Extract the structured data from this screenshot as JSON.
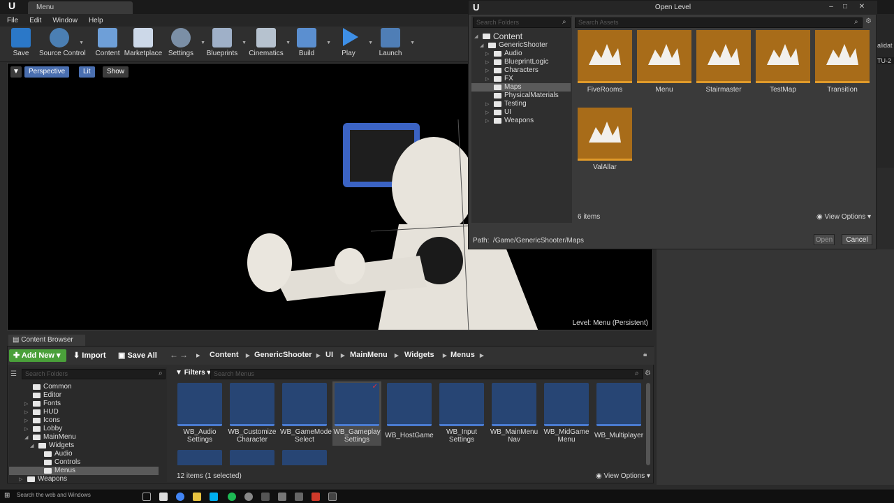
{
  "window": {
    "doc_tab": "Menu",
    "ue_logo": "U"
  },
  "menubar": [
    "File",
    "Edit",
    "Window",
    "Help"
  ],
  "toolbar": [
    "Save",
    "Source Control",
    "Content",
    "Marketplace",
    "Settings",
    "Blueprints",
    "Cinematics",
    "Build",
    "Play",
    "Launch"
  ],
  "viewport": {
    "perspective": "Perspective",
    "lit": "Lit",
    "show": "Show",
    "level_prefix": "Level:",
    "level_name": "Menu (Persistent)"
  },
  "open_level": {
    "title": "Open Level",
    "search_folders_placeholder": "Search Folders",
    "search_assets_placeholder": "Search Assets",
    "tree": [
      {
        "label": "Content",
        "depth": 0
      },
      {
        "label": "GenericShooter",
        "depth": 1
      },
      {
        "label": "Audio",
        "depth": 2
      },
      {
        "label": "BlueprintLogic",
        "depth": 2
      },
      {
        "label": "Characters",
        "depth": 2
      },
      {
        "label": "FX",
        "depth": 2
      },
      {
        "label": "Maps",
        "depth": 2,
        "selected": true
      },
      {
        "label": "PhysicalMaterials",
        "depth": 2
      },
      {
        "label": "Testing",
        "depth": 2
      },
      {
        "label": "UI",
        "depth": 2
      },
      {
        "label": "Weapons",
        "depth": 2
      }
    ],
    "maps": [
      "FiveRooms",
      "Menu",
      "Stairmaster",
      "TestMap",
      "Transition",
      "ValAllar"
    ],
    "count": "6 items",
    "view_options": "View Options",
    "path_label": "Path:",
    "path": "/Game/GenericShooter/Maps",
    "open_btn": "Open",
    "cancel_btn": "Cancel"
  },
  "content_browser": {
    "tab": "Content Browser",
    "add_new": "Add New",
    "import": "Import",
    "save_all": "Save All",
    "breadcrumbs": [
      "Content",
      "GenericShooter",
      "UI",
      "MainMenu",
      "Widgets",
      "Menus"
    ],
    "filters": "Filters",
    "search_folders_placeholder": "Search Folders",
    "search_menus_placeholder": "Search Menus",
    "tree": [
      "Common",
      "Editor",
      "Fonts",
      "HUD",
      "Icons",
      "Lobby",
      "MainMenu",
      "Widgets",
      "Audio",
      "Controls",
      "Menus",
      "Weapons"
    ],
    "assets": [
      {
        "name": "WB_Audio Settings",
        "l1": "WB_Audio",
        "l2": "Settings"
      },
      {
        "name": "WB_Customize Character",
        "l1": "WB_Customize",
        "l2": "Character"
      },
      {
        "name": "WB_GameMode Select",
        "l1": "WB_GameMode",
        "l2": "Select"
      },
      {
        "name": "WB_Gameplay Settings",
        "l1": "WB_Gameplay",
        "l2": "Settings",
        "selected": true
      },
      {
        "name": "WB_HostGame",
        "l1": "WB_HostGame",
        "l2": ""
      },
      {
        "name": "WB_Input Settings",
        "l1": "WB_Input",
        "l2": "Settings"
      },
      {
        "name": "WB_MainMenu Nav",
        "l1": "WB_MainMenu",
        "l2": "Nav"
      },
      {
        "name": "WB_MidGame Menu",
        "l1": "WB_MidGame",
        "l2": "Menu"
      },
      {
        "name": "WB_Multiplayer",
        "l1": "WB_Multiplayer",
        "l2": ""
      }
    ],
    "status": "12 items (1 selected)",
    "view_options": "View Options"
  },
  "right_panel": {
    "partial_text": "alidat",
    "partial_text2": "TU-2"
  },
  "taskbar": {
    "search": "Search the web and Windows"
  }
}
